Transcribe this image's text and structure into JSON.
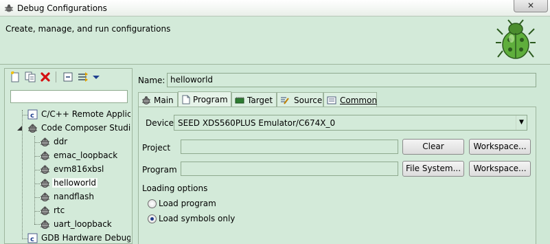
{
  "window": {
    "title": "Debug Configurations",
    "close_label": "✕"
  },
  "banner": {
    "heading": "Create, manage, and run configurations",
    "icon": "bug-icon"
  },
  "toolbar": {
    "icons": [
      "new-config-icon",
      "duplicate-icon",
      "delete-icon",
      "collapse-all-icon",
      "filter-icon",
      "view-menu-icon"
    ]
  },
  "filter": {
    "value": ""
  },
  "tree": {
    "items": [
      {
        "label": "C/C++ Remote Applic",
        "icon": "c-config-icon",
        "level": 0
      },
      {
        "label": "Code Composer Studi",
        "icon": "ccs-bug-icon",
        "level": 0,
        "expanded": true
      },
      {
        "label": "ddr",
        "icon": "bug-icon",
        "level": 1
      },
      {
        "label": "emac_loopback",
        "icon": "bug-icon",
        "level": 1
      },
      {
        "label": "evm816xbsl",
        "icon": "bug-icon",
        "level": 1
      },
      {
        "label": "helloworld",
        "icon": "bug-icon",
        "level": 1,
        "selected": true
      },
      {
        "label": "nandflash",
        "icon": "bug-icon",
        "level": 1
      },
      {
        "label": "rtc",
        "icon": "bug-icon",
        "level": 1
      },
      {
        "label": "uart_loopback",
        "icon": "bug-icon",
        "level": 1
      },
      {
        "label": "GDB Hardware Debug",
        "icon": "c-config-icon",
        "level": 0
      }
    ]
  },
  "config": {
    "name_label": "Name:",
    "name_value": "helloworld",
    "tabs": [
      {
        "label": "Main",
        "icon": "main-tab-icon"
      },
      {
        "label": "Program",
        "icon": "page-icon",
        "active": true
      },
      {
        "label": "Target",
        "icon": "target-icon"
      },
      {
        "label": "Source",
        "icon": "source-icon"
      },
      {
        "label": "Common",
        "icon": "common-icon"
      }
    ],
    "device_label": "Device",
    "device_value": "SEED XDS560PLUS Emulator/C674X_0",
    "project_label": "Project",
    "project_value": "",
    "program_label": "Program",
    "program_value": "",
    "clear_label": "Clear",
    "workspace_label": "Workspace...",
    "file_system_label": "File System...",
    "loading_options_label": "Loading options",
    "load_program_label": "Load program",
    "load_symbols_label": "Load symbols only",
    "selected_loading_option": "Load symbols only"
  },
  "colors": {
    "panel": "#d3ead9",
    "border": "#9db59d",
    "title_bar": "#ffffff"
  }
}
